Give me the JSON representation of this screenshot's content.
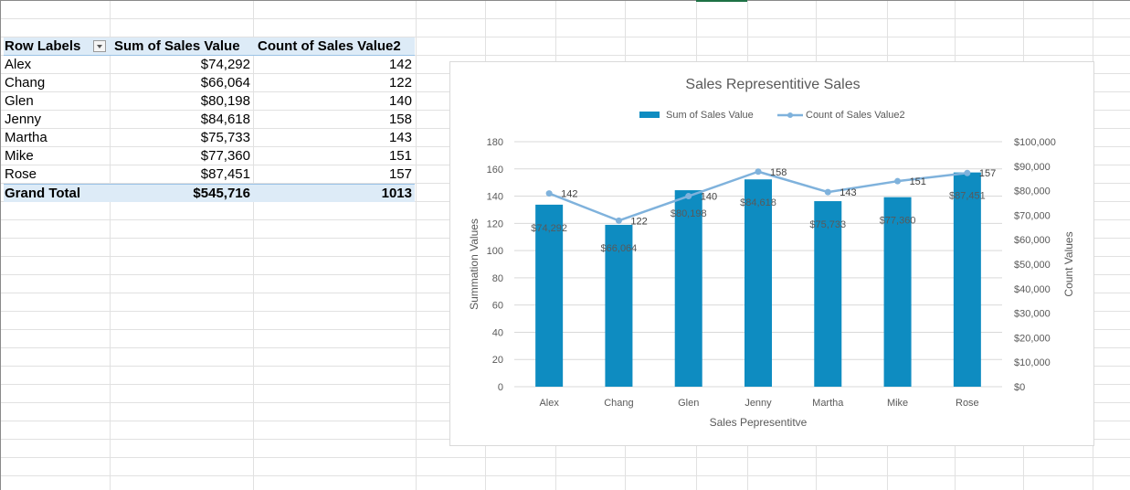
{
  "pivot": {
    "headers": [
      "Row Labels",
      "Sum of Sales Value",
      "Count of Sales Value2"
    ],
    "rows": [
      {
        "label": "Alex",
        "sum": "$74,292",
        "count": "142"
      },
      {
        "label": "Chang",
        "sum": "$66,064",
        "count": "122"
      },
      {
        "label": "Glen",
        "sum": "$80,198",
        "count": "140"
      },
      {
        "label": "Jenny",
        "sum": "$84,618",
        "count": "158"
      },
      {
        "label": "Martha",
        "sum": "$75,733",
        "count": "143"
      },
      {
        "label": "Mike",
        "sum": "$77,360",
        "count": "151"
      },
      {
        "label": "Rose",
        "sum": "$87,451",
        "count": "157"
      }
    ],
    "grand_total": {
      "label": "Grand Total",
      "sum": "$545,716",
      "count": "1013"
    }
  },
  "chart_data": {
    "type": "bar",
    "title": "Sales Representitive Sales",
    "xlabel": "Sales Pepresentitve",
    "ylabel": "Summation Values",
    "y2label": "Count Values",
    "categories": [
      "Alex",
      "Chang",
      "Glen",
      "Jenny",
      "Martha",
      "Mike",
      "Rose"
    ],
    "series": [
      {
        "name": "Sum of Sales Value",
        "type": "bar",
        "axis": "secondary",
        "values": [
          74292,
          66064,
          80198,
          84618,
          75733,
          77360,
          87451
        ],
        "labels": [
          "$74,292",
          "$66,064",
          "$80,198",
          "$84,618",
          "$75,733",
          "$77,360",
          "$87,451"
        ]
      },
      {
        "name": "Count of Sales Value2",
        "type": "line",
        "axis": "primary",
        "values": [
          142,
          122,
          140,
          158,
          143,
          151,
          157
        ],
        "labels": [
          "142",
          "122",
          "140",
          "158",
          "143",
          "151",
          "157"
        ]
      }
    ],
    "ylim": [
      0,
      180
    ],
    "yticks": [
      0,
      20,
      40,
      60,
      80,
      100,
      120,
      140,
      160,
      180
    ],
    "y2lim": [
      0,
      100000
    ],
    "y2ticks": [
      "$0",
      "$10,000",
      "$20,000",
      "$30,000",
      "$40,000",
      "$50,000",
      "$60,000",
      "$70,000",
      "$80,000",
      "$90,000",
      "$100,000"
    ],
    "legend": "top",
    "grid": true,
    "colors": {
      "bar": "#0e8cc1",
      "line": "#7fb2dc"
    }
  }
}
